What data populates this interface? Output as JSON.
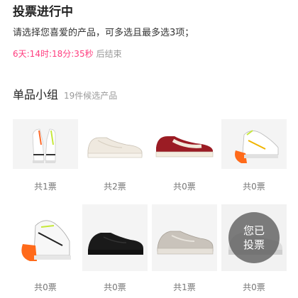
{
  "vote": {
    "title": "投票进行中",
    "description": "请选择您喜爱的产品，可多选且最多选3项；",
    "countdown": "6天:14时:18分:35秒",
    "countdown_suffix": "后结束"
  },
  "group": {
    "title": "单品小组",
    "subtitle": "19件候选产品"
  },
  "products": [
    {
      "icon": "high-top-sneaker-pair-icon",
      "votes": "共1票"
    },
    {
      "icon": "white-low-sneaker-icon",
      "votes": "共2票"
    },
    {
      "icon": "red-low-sneaker-icon",
      "votes": "共0票"
    },
    {
      "icon": "white-orange-sneaker-icon",
      "votes": "共0票"
    },
    {
      "icon": "orange-white-sneaker-icon",
      "votes": "共0票"
    },
    {
      "icon": "black-sneaker-icon",
      "votes": "共0票"
    },
    {
      "icon": "grey-sneaker-icon",
      "votes": "共1票"
    },
    {
      "icon": "voted-sneaker-icon",
      "votes": "共0票",
      "badge_line1": "您已",
      "badge_line2": "投票"
    }
  ],
  "colors": {
    "countdown": "#ff3d7f",
    "muted": "#999999"
  }
}
